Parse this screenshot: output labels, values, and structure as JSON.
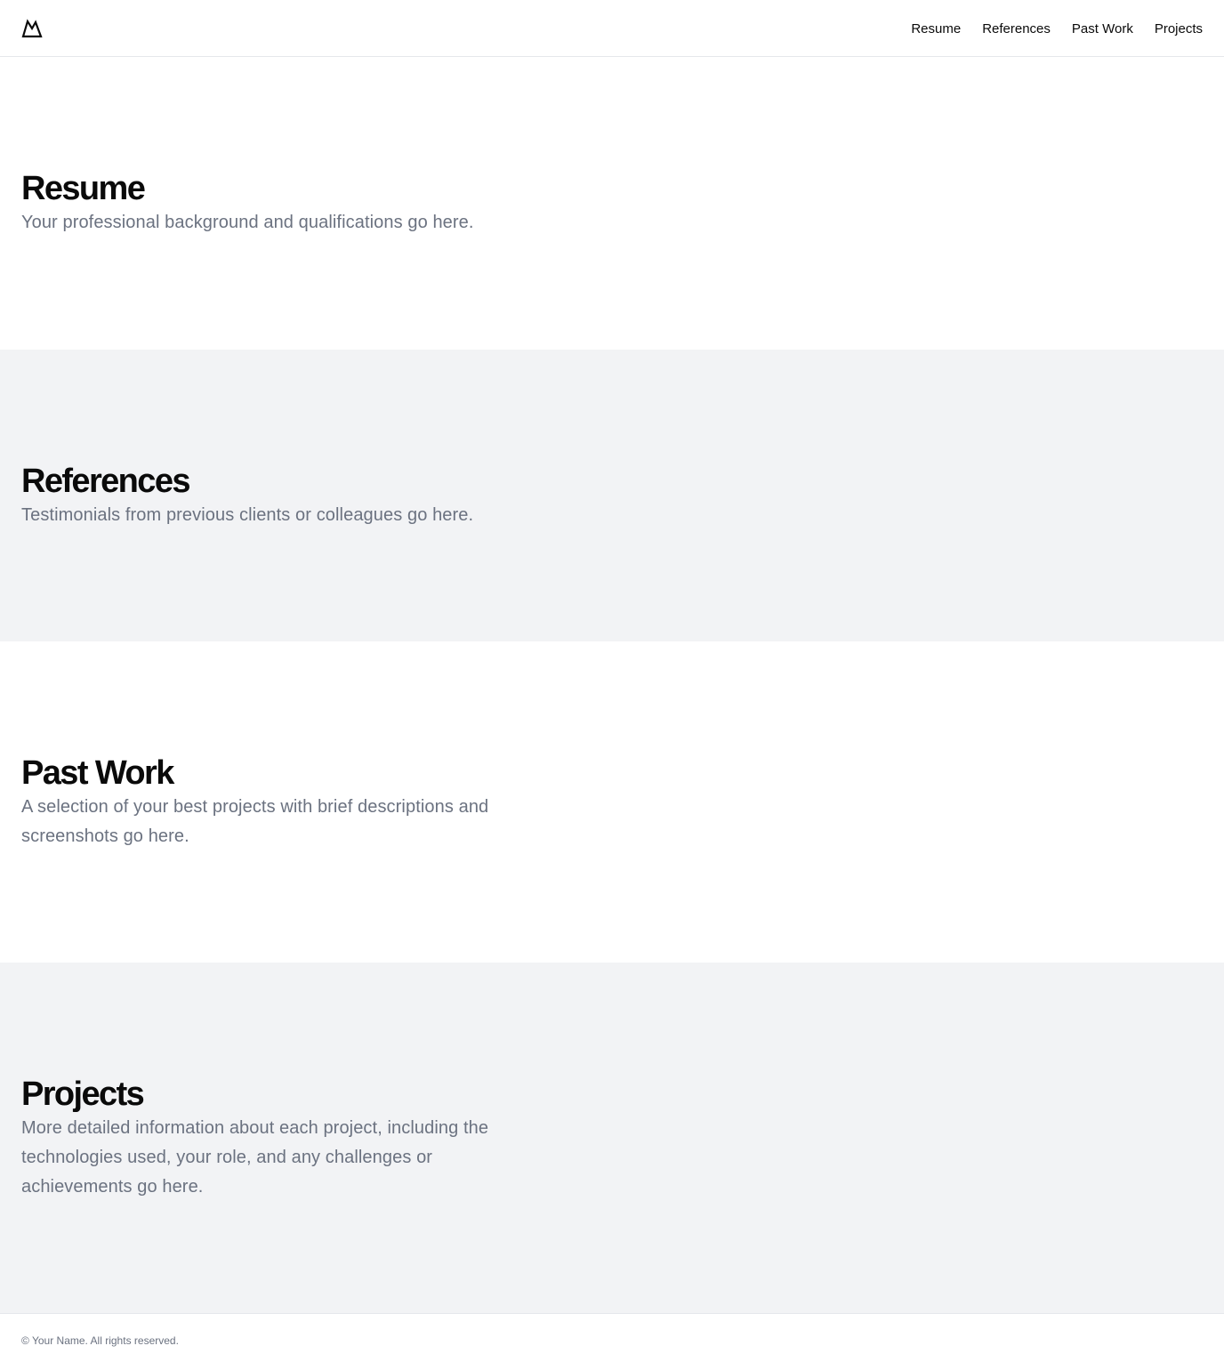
{
  "header": {
    "logo_icon": "mountain-logo-icon",
    "nav": [
      {
        "label": "Resume"
      },
      {
        "label": "References"
      },
      {
        "label": "Past Work"
      },
      {
        "label": "Projects"
      }
    ]
  },
  "sections": {
    "resume": {
      "title": "Resume",
      "description": "Your professional background and qualifications go here."
    },
    "references": {
      "title": "References",
      "description": "Testimonials from previous clients or colleagues go here."
    },
    "past_work": {
      "title": "Past Work",
      "description": "A selection of your best projects with brief descriptions and screenshots go here."
    },
    "projects": {
      "title": "Projects",
      "description": "More detailed information about each project, including the technologies used, your role, and any challenges or achievements go here."
    }
  },
  "footer": {
    "text": "© Your Name. All rights reserved."
  },
  "colors": {
    "text_primary": "#0a0a0a",
    "text_muted": "#6b7280",
    "section_alt_bg": "#f2f3f5",
    "border": "#e5e7eb"
  }
}
